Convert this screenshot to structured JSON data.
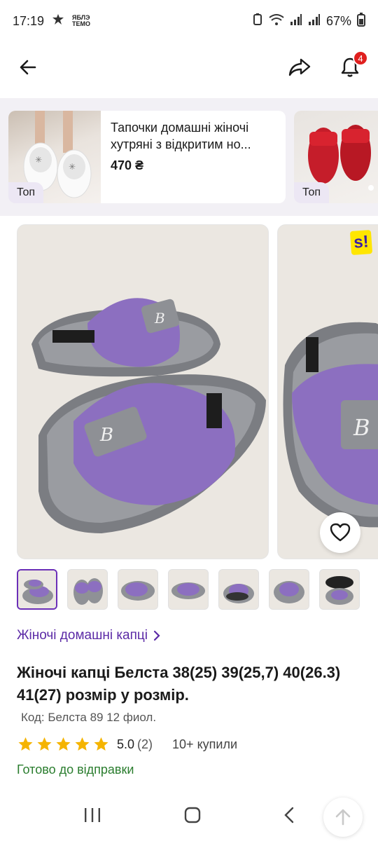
{
  "status_bar": {
    "time": "17:19",
    "app_badge_line1": "ЯБЛЭ",
    "app_badge_line2": "ТЕМО",
    "battery": "67%"
  },
  "app_bar": {
    "notifications_count": "4"
  },
  "recommendations": [
    {
      "title": "Тапочки домашні жіночі хутряні з відкритим но...",
      "price": "470 ₴",
      "tag": "Топ"
    },
    {
      "title": "",
      "price": "",
      "tag": "Топ"
    }
  ],
  "gallery": {
    "brand_logo": "s!",
    "thumbnails_count": 7
  },
  "product": {
    "category": "Жіночі домашні капці",
    "title": "Жіночі капці Белста 38(25) 39(25,7) 40(26.3) 41(27) розмір у розмір.",
    "code": "Код: Белста 89 12 фиол.",
    "rating": "5.0",
    "reviews": "(2)",
    "bought": "10+ купили",
    "availability": "Готово до відправки"
  },
  "colors": {
    "accent": "#5b2aa6",
    "star": "#f5b400",
    "available": "#2a7d2e",
    "badge": "#e0201f"
  }
}
